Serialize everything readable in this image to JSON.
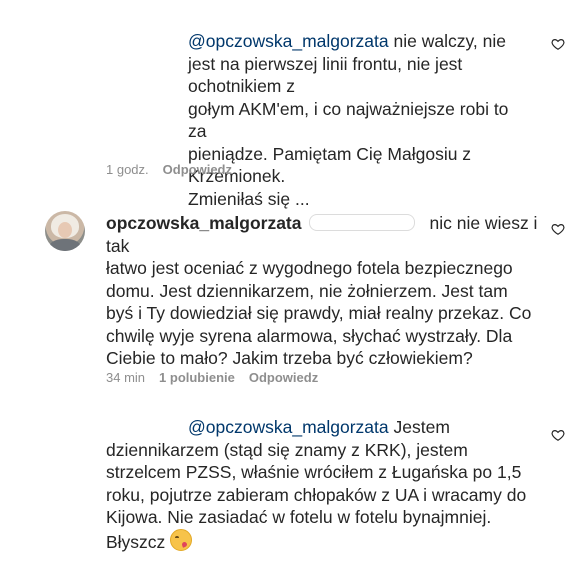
{
  "comments": [
    {
      "mention": "@opczowska_malgorzata",
      "text": " nie walczy, nie\njest na pierwszej linii frontu, nie jest ochotnikiem z\ngołym AKM'em, i co najważniejsze robi to za\npieniądze. Pamiętam Cię Małgosiu z Krzemionek.\nZmieniłaś się ...",
      "time": "1 godz.",
      "reply_label": "Odpowiedz"
    },
    {
      "username": "opczowska_malgorzata",
      "text_first": "nic nie wiesz i tak",
      "text": "łatwo jest oceniać z wygodnego fotela bezpiecznego\ndomu. Jest dziennikarzem, nie żołnierzem. Jest tam\nbyś i Ty dowiedział się prawdy, miał realny przekaz. Co\nchwilę wyje syrena alarmowa, słychać wystrzały. Dla\nCiebie to mało? Jakim trzeba być człowiekiem?",
      "time": "34 min",
      "likes": "1 polubienie",
      "reply_label": "Odpowiedz"
    },
    {
      "mention": "@opczowska_malgorzata",
      "text": " Jestem\ndziennikarzem (stąd się znamy z KRK), jestem\nstrzelcem PZSS, właśnie wróciłem z Ługańska po 1,5\nroku, pojutrze zabieram chłopaków z UA i wracamy do\nKijowa. Nie zasiadać w fotelu w fotelu bynajmniej.\nBłyszcz",
      "emoji": "face-blowing-kiss-emoji"
    }
  ]
}
